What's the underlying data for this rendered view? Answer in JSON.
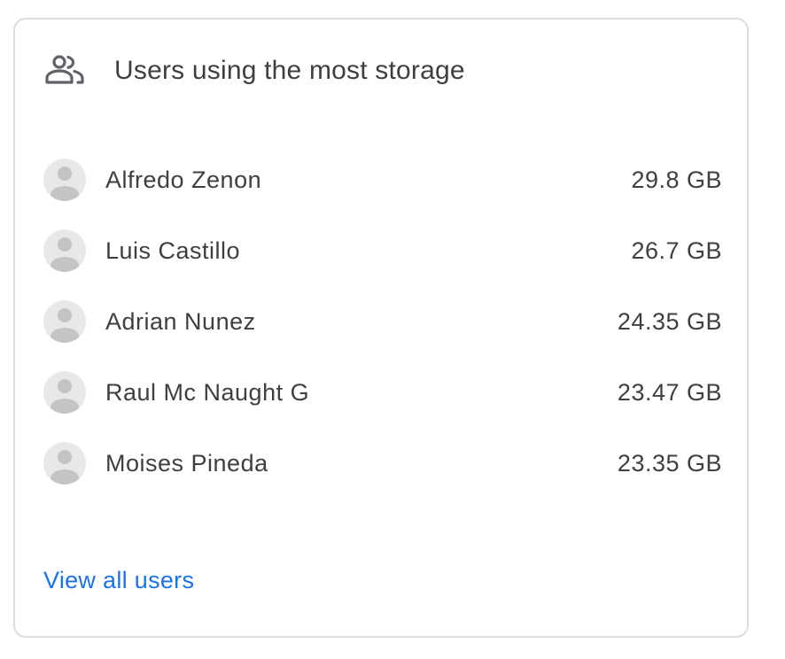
{
  "card": {
    "title": "Users using the most storage",
    "header_icon": "people-outline-icon",
    "avatar_icon": "person-avatar-icon",
    "users": [
      {
        "name": "Alfredo Zenon",
        "storage": "29.8 GB"
      },
      {
        "name": "Luis Castillo",
        "storage": "26.7 GB"
      },
      {
        "name": "Adrian Nunez",
        "storage": "24.35 GB"
      },
      {
        "name": "Raul Mc Naught G",
        "storage": "23.47 GB"
      },
      {
        "name": "Moises Pineda",
        "storage": "23.35 GB"
      }
    ],
    "view_all_label": "View all users"
  },
  "colors": {
    "link": "#1a73e8",
    "text": "#3c4043",
    "border": "#dadce0",
    "avatar_bg": "#e8e8e8",
    "avatar_fg": "#c4c4c4"
  }
}
